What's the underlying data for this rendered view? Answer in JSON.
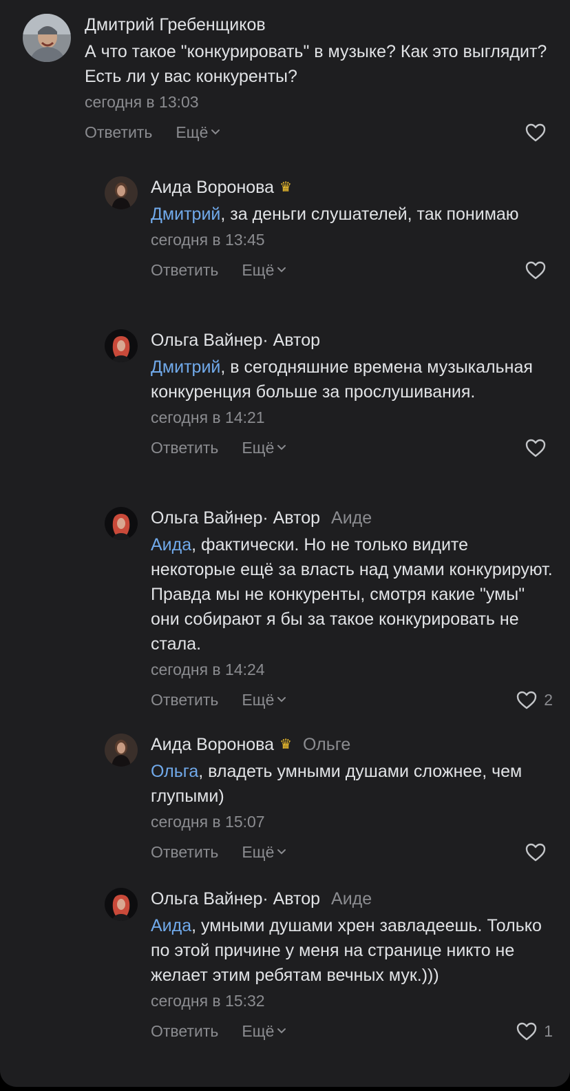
{
  "colors": {
    "background": "#1e1e20",
    "text": "#e1e3e6",
    "secondary": "#8b8c90",
    "mention": "#71aaeb"
  },
  "labels": {
    "reply": "Ответить",
    "more": "Ещё"
  },
  "comments": [
    {
      "author": "Дмитрий Гребенщиков",
      "role": "",
      "reply_to": "",
      "mention": "",
      "text": "А что такое \"конкурировать\" в музыке? Как это выглядит? Есть ли у вас конкуренты?",
      "time": "сегодня в 13:03",
      "likes": ""
    },
    {
      "author": "Аида Воронова",
      "role": "",
      "badge_icon": "crown-icon",
      "reply_to": "",
      "mention": "Дмитрий",
      "text": ", за деньги слушателей, так понимаю",
      "time": "сегодня в 13:45",
      "likes": ""
    },
    {
      "author": "Ольга Вайнер",
      "role": " · Автор",
      "reply_to": "",
      "mention": "Дмитрий",
      "text": ", в сегодняшние времена музыкальная конкуренция больше за прослушивания.",
      "time": "сегодня в 14:21",
      "likes": ""
    },
    {
      "author": "Ольга Вайнер",
      "role": " · Автор",
      "reply_to": "Аиде",
      "mention": "Аида",
      "text": ", фактически. Но не только видите некоторые ещё за власть над умами конкурируют. Правда мы не конкуренты, смотря какие \"умы\" они собирают я бы за такое конкурировать не стала.",
      "time": "сегодня в 14:24",
      "likes": "2"
    },
    {
      "author": "Аида Воронова",
      "role": "",
      "badge_icon": "crown-icon",
      "reply_to": "Ольге",
      "mention": "Ольга",
      "text": ", владеть умными душами сложнее, чем глупыми)",
      "time": "сегодня в 15:07",
      "likes": ""
    },
    {
      "author": "Ольга Вайнер",
      "role": " · Автор",
      "reply_to": "Аиде",
      "mention": "Аида",
      "text": ", умными душами хрен завладеешь. Только по этой причине у меня на странице никто не желает этим ребятам вечных мук.)))",
      "time": "сегодня в 15:32",
      "likes": "1"
    }
  ]
}
